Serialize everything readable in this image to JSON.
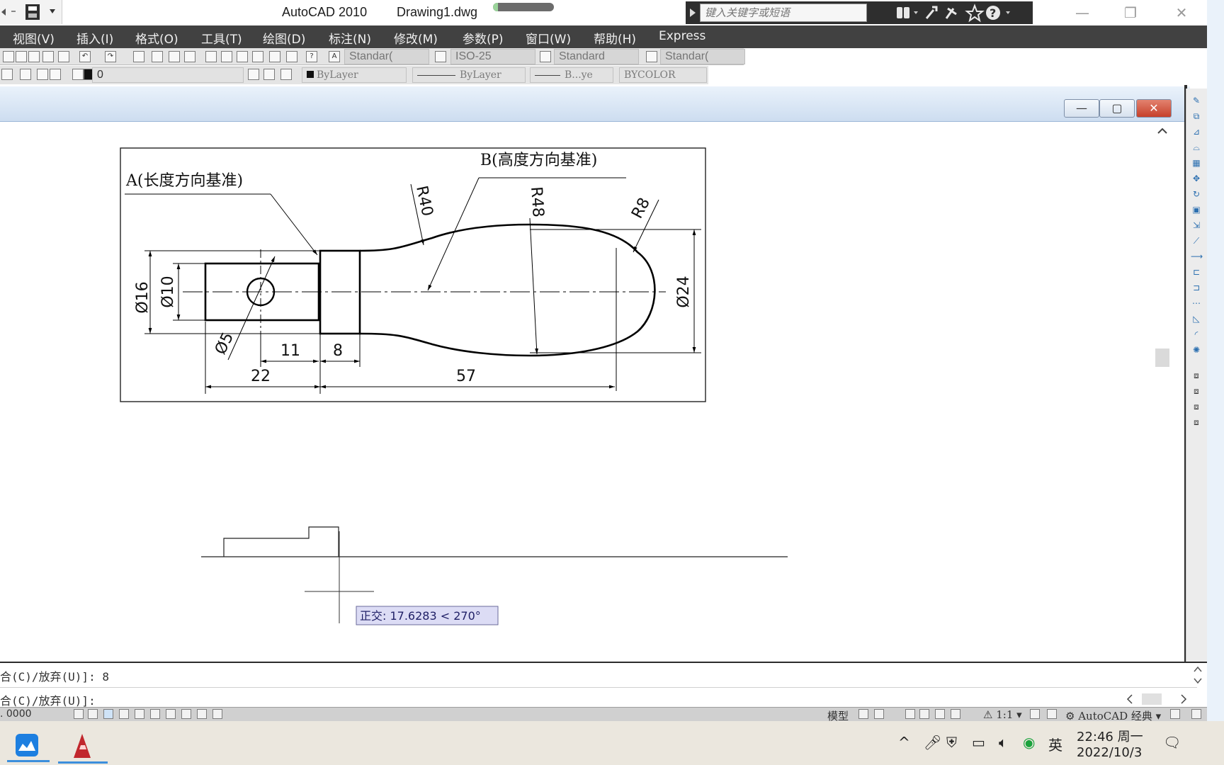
{
  "titlebar": {
    "app_name": "AutoCAD 2010",
    "file_name": "Drawing1.dwg",
    "progress_fraction": 0.08,
    "search_placeholder": "键入关键字或短语"
  },
  "menubar": {
    "items": [
      "视图(V)",
      "插入(I)",
      "格式(O)",
      "工具(T)",
      "绘图(D)",
      "标注(N)",
      "修改(M)",
      "参数(P)",
      "窗口(W)",
      "帮助(H)",
      "Express"
    ]
  },
  "styles_toolbar": {
    "text_style": "Standar(",
    "dim_style": "ISO-25",
    "table_style": "Standard",
    "multileader_style": "Standar("
  },
  "layers_toolbar": {
    "current_layer": "0",
    "color": "ByLayer",
    "linetype": "ByLayer",
    "lineweight": "B...ye",
    "plot_style": "BYCOLOR"
  },
  "drawing": {
    "label_a": "A(长度方向基准)",
    "label_b": "B(高度方向基准)",
    "dims": {
      "r40": "R40",
      "r48": "R48",
      "r8": "R8",
      "d16": "Ø16",
      "d10": "Ø10",
      "d5": "Ø5",
      "d24": "Ø24",
      "len11": "11",
      "len8": "8",
      "len22": "22",
      "len57": "57"
    },
    "tooltip": "正交: 17.6283 < 270°"
  },
  "command": {
    "line1": "合(C)/放弃(U)]: 8",
    "line2": "合(C)/放弃(U)]:"
  },
  "statusbar": {
    "coords": ". 0000",
    "model_label": "模型",
    "annotation_scale": "1:1",
    "workspace": "AutoCAD 经典"
  },
  "taskbar": {
    "time": "22:46 周一",
    "date": "2022/10/3",
    "ime": "英"
  },
  "colors": {
    "menubar_bg": "#414141",
    "accent_blue": "#3c8fdc",
    "close_red": "#c6402a",
    "tooltip_bg": "#dcdcf5"
  }
}
